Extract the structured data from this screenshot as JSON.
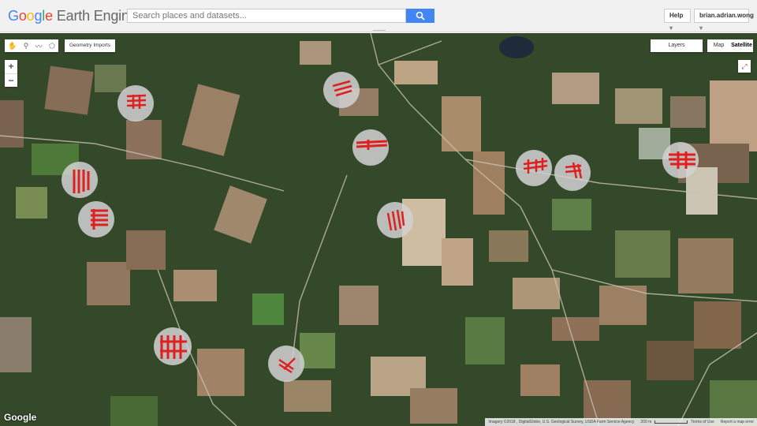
{
  "header": {
    "logo": {
      "google": [
        "G",
        "o",
        "o",
        "g",
        "l",
        "e"
      ],
      "product": "Earth Engine"
    },
    "search": {
      "placeholder": "Search places and datasets..."
    },
    "help_label": "Help",
    "user_label": "brian.adrian.wong"
  },
  "map": {
    "geometry_imports_label": "Geometry Imports",
    "zoom_in_label": "+",
    "zoom_out_label": "−",
    "layers_label": "Layers",
    "maptype": {
      "map_label": "Map",
      "satellite_label": "Satellite",
      "selected": "Satellite"
    },
    "watermark": "Google",
    "attribution": {
      "imagery": "Imagery ©2018 , DigitalGlobe, U.S. Geological Survey, USDA Farm Service Agency",
      "scale": "200 m",
      "terms": "Terms of Use",
      "report": "Report a map error"
    },
    "highlight_color": "#e02020",
    "circle_color": "#d2d2d2"
  }
}
